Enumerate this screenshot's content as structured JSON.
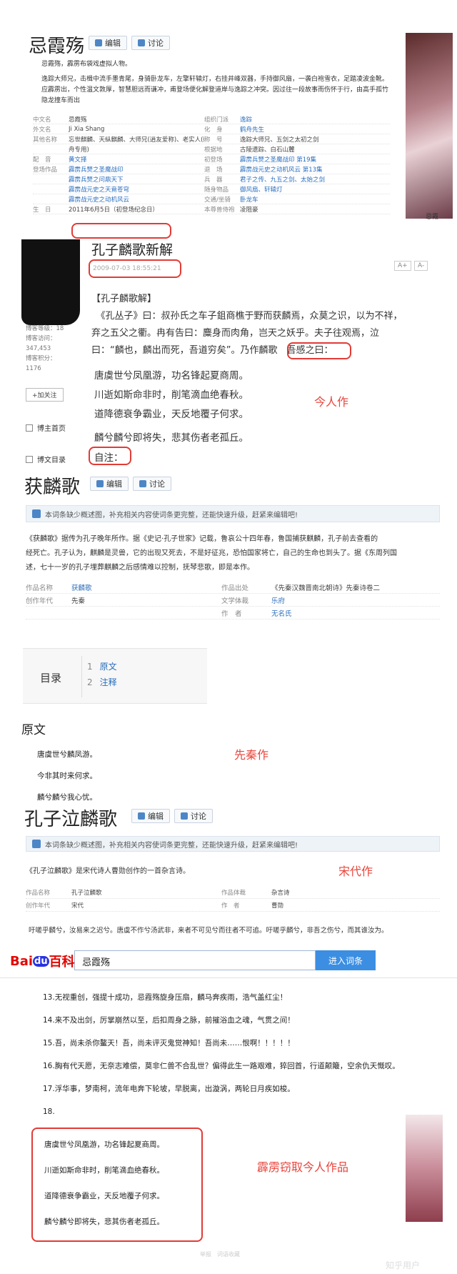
{
  "sec1": {
    "title": "忌霞殇",
    "edit_label": "编辑",
    "discuss_label": "讨论",
    "intro": "忌霞殇，霹雳布袋戏虚拟人物。",
    "desc": "逸踪大师兄，击楫中流手墨青尾，身骑卧龙车，左擎轩辕灯，右挂井峰双器，手持御风扇，一袭白袍雪衣，足踏凌波金靴。应霹雳出，个性温文敦厚，智慧胆远而谦冲，甫登场便化解登道岸与逸踪之冲突。因过往一段故事而伤怀于行，由高手孤竹隐龙撞车而出",
    "rows": [
      [
        "中文名",
        "忌霞殇",
        "组织门派",
        "逸踪"
      ],
      [
        "外文名",
        "Ji Xia Shang",
        "化　身",
        "鹤舟先生"
      ],
      [
        "其他名称",
        "忘世麒麟、天纵麒麟、大师兄(逍友爱称)、老实人(鹤",
        "称　号",
        "逸踪大师兄、五剑之太初之剑"
      ],
      [
        "",
        "舟专用)",
        "根据地",
        "古陵遗踪、白石山麓"
      ],
      [
        "配　音",
        "黄文择",
        "初登场",
        "霹雳兵燹之圣魔战印 第19集"
      ],
      [
        "登场作品",
        "霹雳兵燹之圣魔战印",
        "退　场",
        "霹雳战元史之动机风云 第13集"
      ],
      [
        "",
        "霹雳兵燹之问鼎天下",
        "兵　器",
        "君子之传、九五之剑、太始之剑"
      ],
      [
        "",
        "霹雳战元史之天竟苍穹",
        "随身物品",
        "御风扇、轩辕灯"
      ],
      [
        "",
        "霹雳战元史之动机风云",
        "交通/坐骑",
        "卧龙车"
      ],
      [
        "生　日",
        "2011年6月5日（初登场纪念日）",
        "本尊兽侍袍",
        "凌阻豪"
      ]
    ],
    "side_label": "忌霞"
  },
  "sec2": {
    "title": "孔子麟歌新解",
    "date": "2009-07-03 18:55:21",
    "font_big": "A+",
    "font_small": "A-",
    "stats": [
      "博客等级：18",
      "博客访问：",
      "347,453",
      "博客积分：",
      "1176"
    ],
    "follow": "+加关注",
    "home": "博主首页",
    "catalog": "博文目录",
    "lines": [
      "【孔子麟歌解】",
      "　《孔丛子》曰：叔孙氏之车子鉏商樵于野而获麟焉，众莫之识，以为不祥，",
      "弃之五父之衢。冉有告曰：麋身而肉角，岂天之妖乎。夫子往观焉，泣",
      "曰：“麟也，麟出而死，吾道穷矣”。乃作麟歌　吾感之曰："
    ],
    "poem": [
      "唐虞世兮凤凰游，功名锋起夏商周。",
      "川逝如斯命非时，削笔滴血绝春秋。",
      "道降德衰争霸业，天反地覆子何求。",
      "麟兮麟兮即将失，悲其伤者老孤丘。"
    ],
    "note": "自注：",
    "annot": "今人作"
  },
  "sec3": {
    "title": "获麟歌",
    "edit_label": "编辑",
    "discuss_label": "讨论",
    "notice": "本词条缺少概述图，补充相关内容使词条更完整，还能快速升级，赶紧来编辑吧!",
    "p1": "《获麟歌》据传为孔子晚年所作。据《史记·孔子世家》记载，鲁哀公十四年春，鲁国捕获麒麟，孔子前去查看的",
    "p2": "经死亡。孔子认为，麒麟是灵兽，它的出现又死去，不是好征兆，恐怕国家将亡，自己的生命也到头了。据《东周列国",
    "p3": "述，七十一岁的孔子埋葬麒麟之后感情难以控制，抚琴悲歌，即是本作。",
    "rows": [
      [
        "作品名称",
        "获麟歌",
        "作品出处",
        "《先秦汉魏晋南北朝诗》先秦诗卷二"
      ],
      [
        "创作年代",
        "先秦",
        "文学体裁",
        "乐府"
      ],
      [
        "",
        "",
        "作　者",
        "无名氏"
      ]
    ],
    "toc_label": "目录",
    "toc": [
      [
        "1",
        "原文"
      ],
      [
        "2",
        "注释"
      ]
    ],
    "orig_title": "原文",
    "orig": [
      "唐虞世兮麟凤游。",
      "今非其时来何求。",
      "麟兮麟兮我心忧。"
    ],
    "annot": "先秦作"
  },
  "sec4": {
    "title": "孔子泣麟歌",
    "edit_label": "编辑",
    "discuss_label": "讨论",
    "notice": "本词条缺少概述图，补充相关内容使词条更完整，还能快速升级，赶紧来编辑吧!",
    "intro": "《孔子泣麟歌》是宋代诗人曹勋创作的一首杂言诗。",
    "rows": [
      [
        "作品名称",
        "孔子泣麟歌",
        "作品体裁",
        "杂言诗"
      ],
      [
        "创作年代",
        "宋代",
        "作　者",
        "曹勋"
      ]
    ],
    "body": "吁嗟乎麟兮，汝易来之迟兮。唐虞不作兮汤武非，来者不可见兮而往者不可追。吁嗟乎麟兮，非吾之伤兮，而其谁汝为。",
    "annot": "宋代作"
  },
  "sec5": {
    "logo_text": "Bai",
    "logo_du": "du",
    "logo_baike": "百科",
    "search_value": "忌霞殇",
    "search_btn": "进入词条",
    "items": [
      "13.无视重创，强提十成功，忌霞殇旋身压扇，麟马奔疾雨，浩气盖红尘！",
      "14.来不及出剑，厉掌崩然以至，后扣周身之脉，前摧浴血之魂，气贯之间！",
      "15.吾，尚未杀你鳌天！吾，尚未评灭鬼觉神知！吾尚未……恨啊！！！！！",
      "16.胸有代天愿，无奈志难偿，莫非仁兽不合乱世？偏得此生一路艰难，猝回首，行道颠簸，空余仇天慨叹。",
      "17.浮华事，梦南柯，流年电奔下轮坡，早脱离，出漩涡，两轮日月疾如梭。",
      "18."
    ],
    "poem": [
      "唐虞世兮凤凰游，功名锋起夏商周。",
      "川逝如斯命非时，削笔滴血绝春秋。",
      "道降德衰争霸业，天反地覆子何求。",
      "麟兮麟兮即将失，悲其伤者老孤丘。"
    ],
    "annot": "霹雳窃取今人作品",
    "footer": "举报　词语收藏",
    "watermark": "知乎用户"
  }
}
